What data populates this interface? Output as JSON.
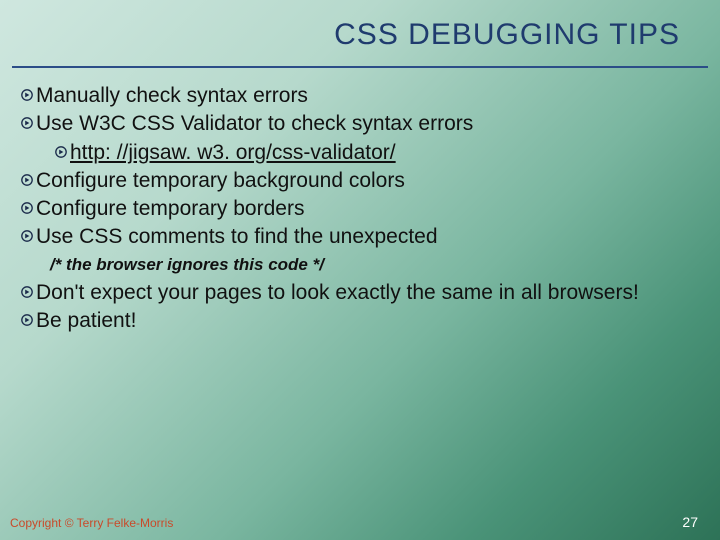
{
  "title": "CSS DEBUGGING TIPS",
  "bullets": {
    "b1": "Manually check syntax errors",
    "b2": "Use W3C CSS Validator to check  syntax errors",
    "b2a": "http: //jigsaw. w3. org/css-validator/",
    "b3": "Configure temporary background colors",
    "b4": "Configure temporary borders",
    "b5": "Use CSS comments to find the unexpected",
    "code": "/* the browser ignores this code */",
    "b6": "Don't expect your pages to look exactly the same in all browsers!",
    "b7": "Be patient!"
  },
  "footer": {
    "copyright": "Copyright © Terry Felke-Morris",
    "page": "27"
  }
}
